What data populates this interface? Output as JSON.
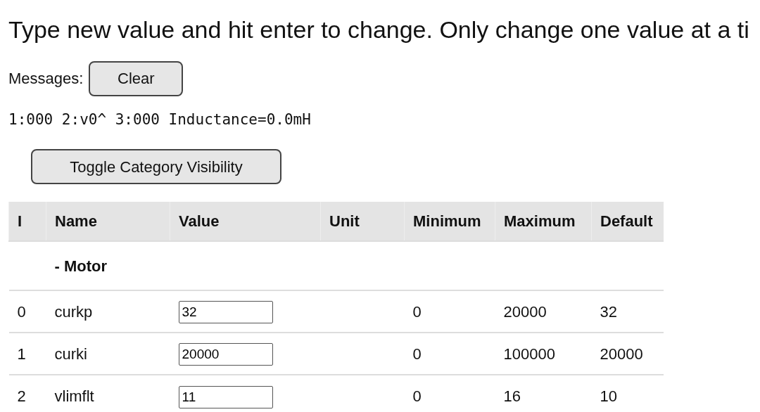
{
  "instructions": "Type new value and hit enter to change. Only change one value at a ti",
  "messages": {
    "label": "Messages:",
    "button": "Clear",
    "status": "1:000 2:v0^ 3:000 Inductance=0.0mH"
  },
  "toggle_button": "Toggle Category Visibility",
  "table": {
    "columns": [
      "I",
      "Name",
      "Value",
      "Unit",
      "Minimum",
      "Maximum",
      "Default"
    ],
    "rows": [
      {
        "kind": "category",
        "name": "- Motor"
      },
      {
        "kind": "param",
        "index": "0",
        "name": "curkp",
        "value": "32",
        "minimum": "0",
        "maximum": "20000",
        "default": "32"
      },
      {
        "kind": "param",
        "index": "1",
        "name": "curki",
        "value": "20000",
        "minimum": "0",
        "maximum": "100000",
        "default": "20000"
      },
      {
        "kind": "param",
        "index": "2",
        "name": "vlimflt",
        "value": "11",
        "minimum": "0",
        "maximum": "16",
        "default": "10"
      }
    ]
  }
}
